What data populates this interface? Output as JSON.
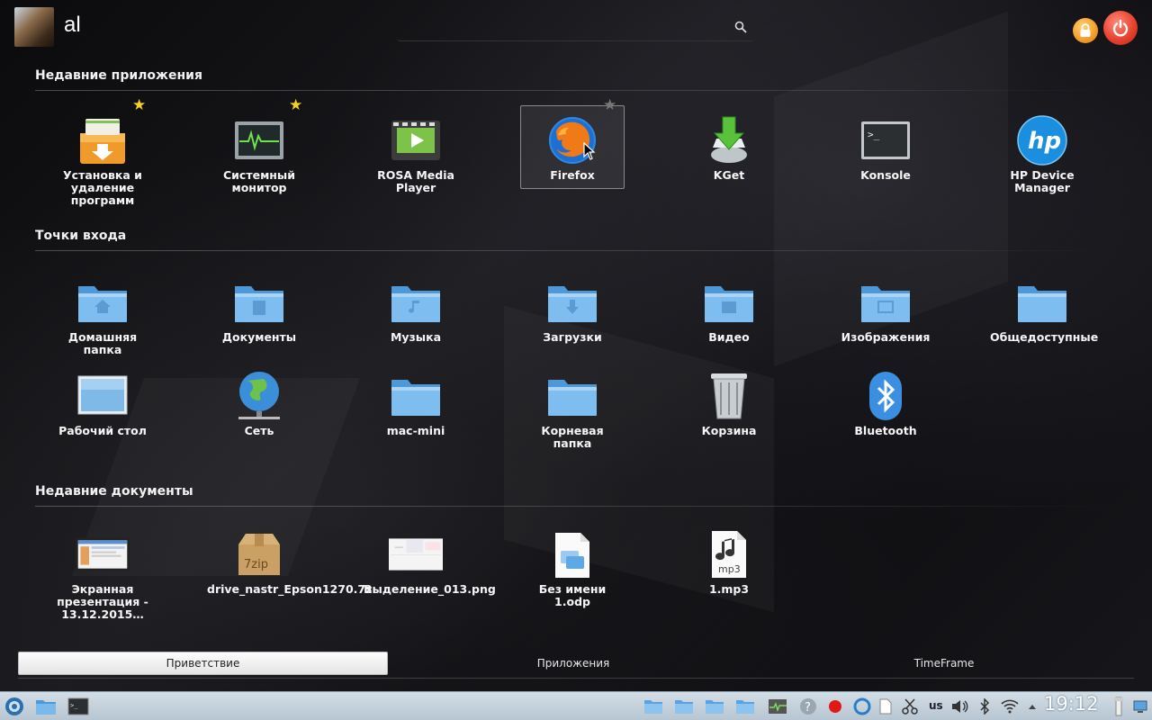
{
  "header": {
    "username": "al",
    "search_placeholder": ""
  },
  "sections": {
    "recent_apps": "Недавние приложения",
    "entry_points": "Точки входа",
    "recent_docs": "Недавние документы"
  },
  "recent_apps": [
    {
      "label": "Установка и удаление программ",
      "icon": "package-install-icon",
      "favorite": true
    },
    {
      "label": "Системный монитор",
      "icon": "system-monitor-icon",
      "favorite": true
    },
    {
      "label": "ROSA Media Player",
      "icon": "media-player-icon",
      "favorite": false
    },
    {
      "label": "Firefox",
      "icon": "firefox-icon",
      "favorite": false
    },
    {
      "label": "KGet",
      "icon": "kget-download-icon",
      "favorite": false
    },
    {
      "label": "Konsole",
      "icon": "terminal-icon",
      "favorite": false
    },
    {
      "label": "HP Device Manager",
      "icon": "hp-logo-icon",
      "favorite": false
    }
  ],
  "places": [
    {
      "label": "Домашняя папка",
      "icon": "home-folder-icon"
    },
    {
      "label": "Документы",
      "icon": "documents-folder-icon"
    },
    {
      "label": "Музыка",
      "icon": "music-folder-icon"
    },
    {
      "label": "Загрузки",
      "icon": "downloads-folder-icon"
    },
    {
      "label": "Видео",
      "icon": "video-folder-icon"
    },
    {
      "label": "Изображения",
      "icon": "pictures-folder-icon"
    },
    {
      "label": "Общедоступные",
      "icon": "public-folder-icon"
    },
    {
      "label": "Рабочий стол",
      "icon": "desktop-icon"
    },
    {
      "label": "Сеть",
      "icon": "network-globe-icon"
    },
    {
      "label": "mac-mini",
      "icon": "folder-icon"
    },
    {
      "label": "Корневая папка",
      "icon": "root-folder-icon"
    },
    {
      "label": "Корзина",
      "icon": "trash-icon"
    },
    {
      "label": "Bluetooth",
      "icon": "bluetooth-icon"
    }
  ],
  "recent_docs": [
    {
      "label": "Экранная презентация - 13.12.2015…",
      "icon": "presentation-thumbnail-icon"
    },
    {
      "label": "drive_nastr_Epson1270.7z",
      "icon": "7zip-archive-icon"
    },
    {
      "label": "Выделение_013.png",
      "icon": "image-thumbnail-icon"
    },
    {
      "label": "Без имени 1.odp",
      "icon": "odp-document-icon"
    },
    {
      "label": "1.mp3",
      "icon": "mp3-file-icon"
    }
  ],
  "tabs": [
    {
      "label": "Приветствие",
      "active": true
    },
    {
      "label": "Приложения",
      "active": false
    },
    {
      "label": "TimeFrame",
      "active": false
    }
  ],
  "taskbar": {
    "clock": "19:12",
    "keyboard_layout": "us"
  },
  "colors": {
    "folder_blue": "#6fb3ea",
    "favorite_star": "#f3d023",
    "taskbar": "#c6d3de"
  }
}
